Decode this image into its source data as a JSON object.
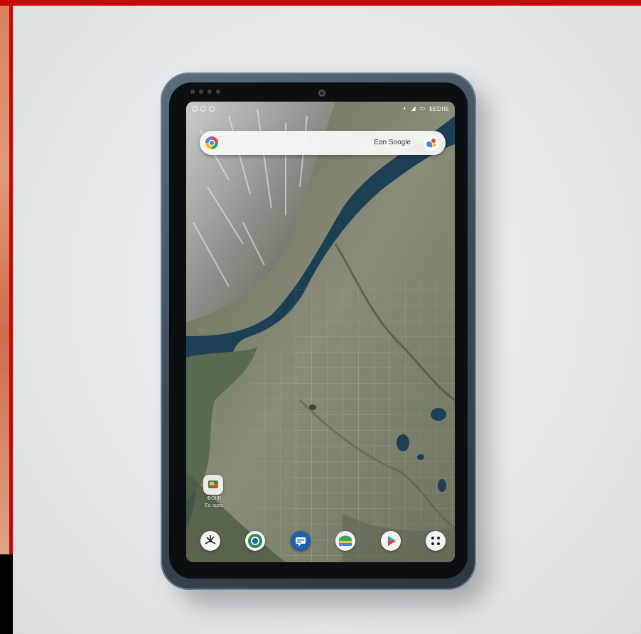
{
  "search": {
    "text": "Eɑn Soogle"
  },
  "status_bar": {
    "right_text": "EEDIIE"
  },
  "home_widget": {
    "label_line1": "IBOIIR",
    "label_line2": "Ea agoɑ"
  },
  "dock": [
    {
      "icon": "wind-fan-icon",
      "accent": "#1b2329"
    },
    {
      "icon": "chrome-icon",
      "accent": "#2e8b57"
    },
    {
      "icon": "chat-icon",
      "accent": "#1f5fad"
    },
    {
      "icon": "maps-icon",
      "accent": "#3aa657"
    },
    {
      "icon": "play-store-icon",
      "accent": "#e53935"
    },
    {
      "icon": "app-drawer-icon",
      "accent": "#1b2329"
    }
  ],
  "colors": {
    "water": "#1d3f54",
    "frame": "#3f4d59",
    "accent_red": "#c40808"
  }
}
